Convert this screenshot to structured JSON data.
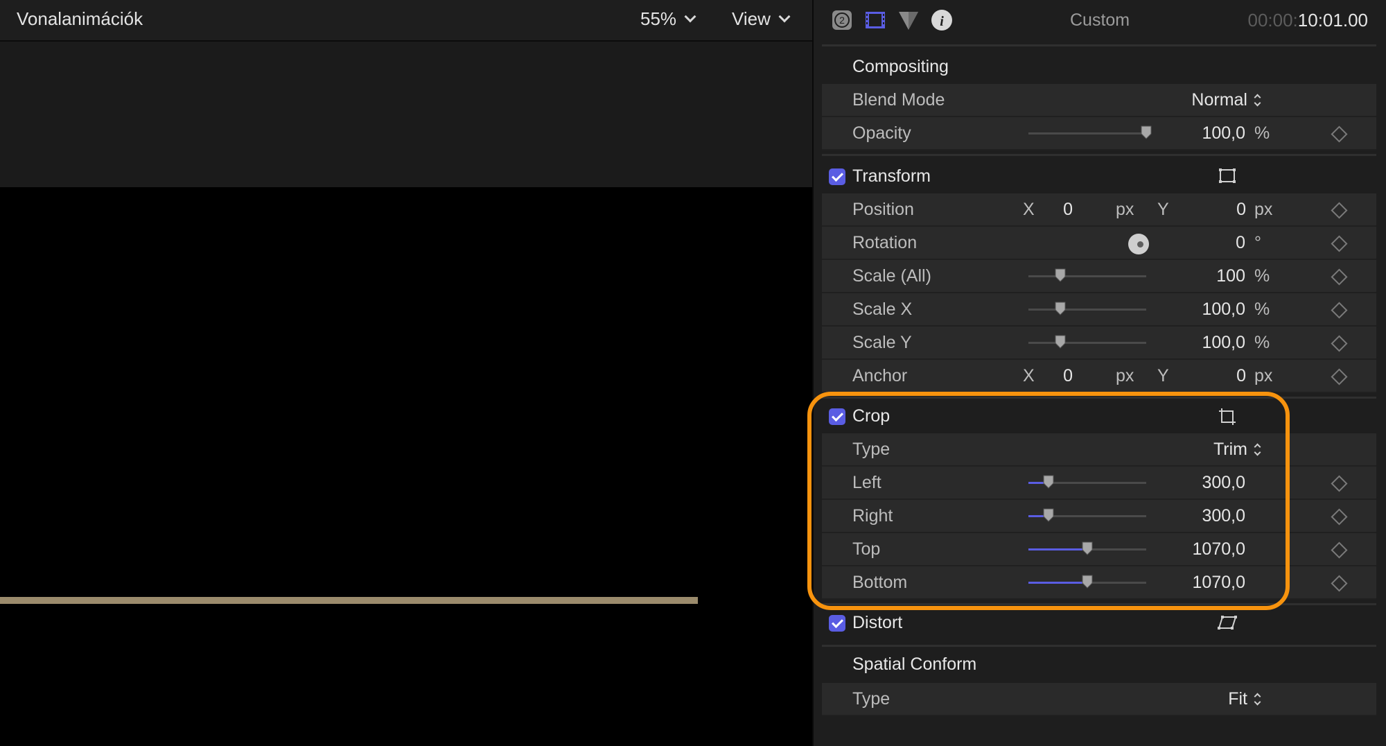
{
  "viewer": {
    "title": "Vonalanimációk",
    "zoom": "55%",
    "view_menu": "View",
    "line_color": "#9b8b6c"
  },
  "inspector": {
    "icons": [
      "info-badge-icon",
      "video-inspector-icon",
      "color-inspector-icon",
      "info-icon"
    ],
    "preset": "Custom",
    "timecode_dim": "00:00:",
    "timecode": "10:01.00",
    "compositing": {
      "title": "Compositing",
      "blend_mode": {
        "label": "Blend Mode",
        "value": "Normal"
      },
      "opacity": {
        "label": "Opacity",
        "value": "100,0",
        "unit": "%",
        "level": 1.0
      }
    },
    "transform": {
      "title": "Transform",
      "enabled": true,
      "position": {
        "label": "Position",
        "x_label": "X",
        "x": "0",
        "x_unit": "px",
        "y_label": "Y",
        "y": "0",
        "y_unit": "px"
      },
      "rotation": {
        "label": "Rotation",
        "value": "0",
        "unit": "°"
      },
      "scale_all": {
        "label": "Scale (All)",
        "value": "100",
        "unit": "%",
        "level": 0.27
      },
      "scale_x": {
        "label": "Scale X",
        "value": "100,0",
        "unit": "%",
        "level": 0.27
      },
      "scale_y": {
        "label": "Scale Y",
        "value": "100,0",
        "unit": "%",
        "level": 0.27
      },
      "anchor": {
        "label": "Anchor",
        "x_label": "X",
        "x": "0",
        "x_unit": "px",
        "y_label": "Y",
        "y": "0",
        "y_unit": "px"
      }
    },
    "crop": {
      "title": "Crop",
      "enabled": true,
      "type": {
        "label": "Type",
        "value": "Trim"
      },
      "left": {
        "label": "Left",
        "value": "300,0",
        "level": 0.17
      },
      "right": {
        "label": "Right",
        "value": "300,0",
        "level": 0.17
      },
      "top": {
        "label": "Top",
        "value": "1070,0",
        "level": 0.5
      },
      "bottom": {
        "label": "Bottom",
        "value": "1070,0",
        "level": 0.5
      }
    },
    "distort": {
      "title": "Distort",
      "enabled": true
    },
    "spatial_conform": {
      "title": "Spatial Conform",
      "type": {
        "label": "Type",
        "value": "Fit"
      }
    },
    "colors": {
      "accent": "#5a5de3",
      "highlight": "#f7930e"
    }
  }
}
